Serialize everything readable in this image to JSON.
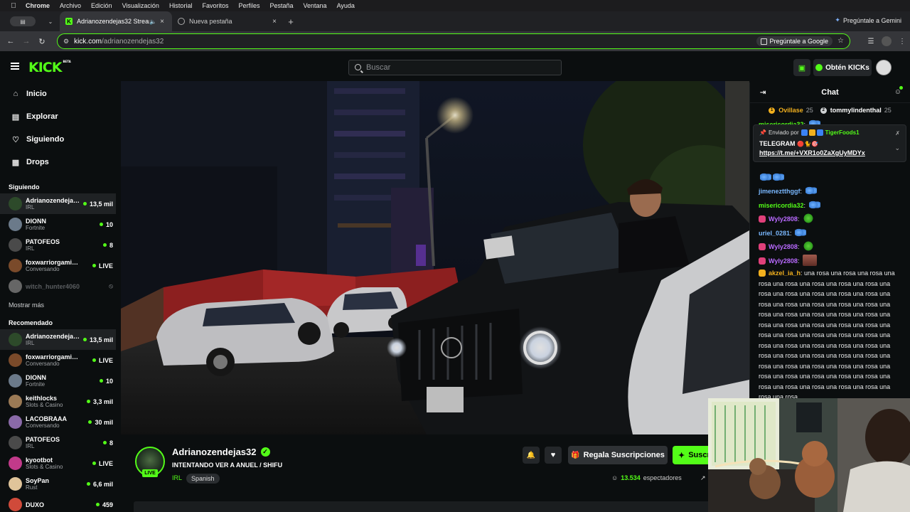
{
  "menubar": {
    "items": [
      "Chrome",
      "Archivo",
      "Edición",
      "Visualización",
      "Historial",
      "Favoritos",
      "Perfiles",
      "Pestaña",
      "Ventana",
      "Ayuda"
    ]
  },
  "tabs": [
    {
      "title": "Adrianozendejas32 Stream",
      "icon": "kick-icon",
      "active": true
    },
    {
      "title": "Nueva pestaña",
      "icon": "globe-icon",
      "active": false
    }
  ],
  "gemini": {
    "label": "Pregúntale a Gemini"
  },
  "address": {
    "host": "kick.com",
    "path": "/adrianozendejas32",
    "ask_google": "Pregúntale a Google"
  },
  "header": {
    "logo": "KICK",
    "logo_beta": "BETA",
    "search_placeholder": "Buscar",
    "kicks_label": "Obtén KICKs"
  },
  "sidebar": {
    "nav": [
      {
        "label": "Inicio",
        "icon": "home-icon"
      },
      {
        "label": "Explorar",
        "icon": "compass-icon"
      },
      {
        "label": "Siguiendo",
        "icon": "heart-icon"
      },
      {
        "label": "Drops",
        "icon": "drops-icon"
      }
    ],
    "following_title": "Siguiendo",
    "following": [
      {
        "name": "Adrianozendejas32",
        "category": "IRL",
        "viewers": "13,5 mil",
        "selected": true,
        "color": "#2d4a2a"
      },
      {
        "name": "DIONN",
        "category": "Fortnite",
        "viewers": "10",
        "color": "#6b7a8a"
      },
      {
        "name": "PATOFEOS",
        "category": "IRL",
        "viewers": "8",
        "color": "#4a4a4a"
      },
      {
        "name": "foxwarriorgaming4",
        "category": "Conversando",
        "viewers": "LIVE",
        "color": "#7a4a2a"
      },
      {
        "name": "witch_hunter4060",
        "category": "",
        "viewers": "",
        "offline": true,
        "color": "#666"
      }
    ],
    "show_more": "Mostrar más",
    "recommended_title": "Recomendado",
    "recommended": [
      {
        "name": "Adrianozendejas32",
        "category": "IRL",
        "viewers": "13,5 mil",
        "selected": true,
        "color": "#2d4a2a"
      },
      {
        "name": "foxwarriorgaming4",
        "category": "Conversando",
        "viewers": "LIVE",
        "color": "#7a4a2a"
      },
      {
        "name": "DIONN",
        "category": "Fortnite",
        "viewers": "10",
        "color": "#6b7a8a"
      },
      {
        "name": "keithlocks",
        "category": "Slots & Casino",
        "viewers": "3,3 mil",
        "color": "#9b7a55"
      },
      {
        "name": "LACOBRAAA",
        "category": "Conversando",
        "viewers": "30 mil",
        "color": "#8a6aa8"
      },
      {
        "name": "PATOFEOS",
        "category": "IRL",
        "viewers": "8",
        "color": "#4a4a4a"
      },
      {
        "name": "kyootbot",
        "category": "Slots & Casino",
        "viewers": "LIVE",
        "color": "#c23a8a"
      },
      {
        "name": "SoyPan",
        "category": "Rust",
        "viewers": "6,6 mil",
        "color": "#e0c49a"
      },
      {
        "name": "DUXO",
        "category": "",
        "viewers": "459",
        "color": "#d04a3a"
      }
    ]
  },
  "channel": {
    "name": "Adrianozendejas32",
    "live_badge": "LIVE",
    "stream_title": "INTENTANDO VER A ANUEL / SHIFU",
    "category": "IRL",
    "language": "Spanish",
    "gift_label": "Regala Suscripciones",
    "subscribe_label": "Suscribirse",
    "viewers_count": "13.534",
    "viewers_label": "espectadores"
  },
  "chat": {
    "title": "Chat",
    "leaders": [
      {
        "name": "Ovillase",
        "count": "25",
        "medal_color": "#f2b01e"
      },
      {
        "name": "tommylindenthal",
        "count": "25",
        "medal_color": "#cfd2d4"
      }
    ],
    "pinned": {
      "by_label": "Enviado por",
      "user": "TigerFoods1",
      "line1": "TELEGRAM",
      "line2": "https://t.me/+VXR1o0ZaXgUyMDYx"
    },
    "messages": [
      {
        "user": "misericordia32",
        "color": "#53fc18",
        "text": "",
        "emote": "bf",
        "top": true
      },
      {
        "user": "",
        "color": "#53fc18",
        "text": "",
        "emote": "bf2"
      },
      {
        "user": "jimeneztthggf",
        "color": "#7ab8ff",
        "text": "",
        "emote": "bf"
      },
      {
        "user": "misericordia32",
        "color": "#53fc18",
        "text": "",
        "emote": "bf"
      },
      {
        "user": "Wyly2808",
        "color": "#b96aff",
        "text": "",
        "emote": "green",
        "badge": "#e0407a"
      },
      {
        "user": "uriel_0281",
        "color": "#7ab8ff",
        "text": "",
        "emote": "bf"
      },
      {
        "user": "Wyly2808",
        "color": "#b96aff",
        "text": "",
        "emote": "green",
        "badge": "#e0407a"
      },
      {
        "user": "Wyly2808",
        "color": "#b96aff",
        "text": "",
        "emote": "car",
        "badge": "#e0407a"
      },
      {
        "user": "akzel_ia_h",
        "color": "#f2b01e",
        "badge": "#f2b01e",
        "text": "una rosa una rosa una rosa una rosa una rosa una rosa una rosa una rosa una rosa una rosa una rosa una rosa una rosa una rosa una rosa una rosa una rosa una rosa una rosa una rosa una rosa una rosa una rosa una rosa una rosa una rosa una rosa una rosa una rosa una rosa una rosa una rosa una rosa una rosa una rosa una rosa una rosa una rosa una rosa una rosa una rosa una rosa una rosa una rosa una rosa una rosa una rosa una rosa una rosa una rosa una rosa una rosa una rosa una rosa una rosa una rosa una rosa una rosa una rosa una rosa"
      }
    ]
  }
}
